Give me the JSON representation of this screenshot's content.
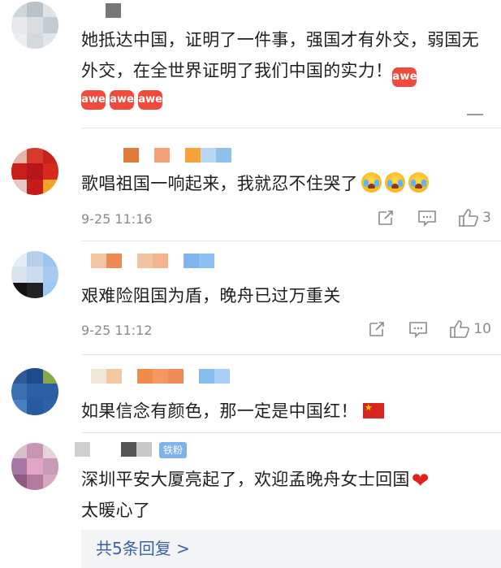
{
  "comments": [
    {
      "text": "她抵达中国，证明了一件事，强国才有外交，弱国无外交，在全世界证明了我们中国的实力！",
      "sticker": "awesome-sticker"
    },
    {
      "text": "歌唱祖国一响起来，我就忍不住哭了",
      "emoji": "crying-face",
      "time": "9-25 11:16",
      "likes": "3"
    },
    {
      "text": "艰难险阻国为盾，晚舟已过万重关",
      "time": "9-25 11:12",
      "likes": "10"
    },
    {
      "text": "如果信念有颜色，那一定是中国红！",
      "emoji": "china-flag"
    },
    {
      "badge": "铁粉",
      "text": "深圳平安大厦亮起了，欢迎孟晚舟女士回国",
      "text2": "太暖心了",
      "emoji": "red-heart"
    }
  ],
  "replies": {
    "label": "共5条回复 >"
  },
  "colors": {
    "reply_link": "#3a62a8",
    "meta_gray": "#8a8a8a",
    "badge_blue": "#7fb3e8",
    "sticker_red": "#ef4a3c"
  }
}
